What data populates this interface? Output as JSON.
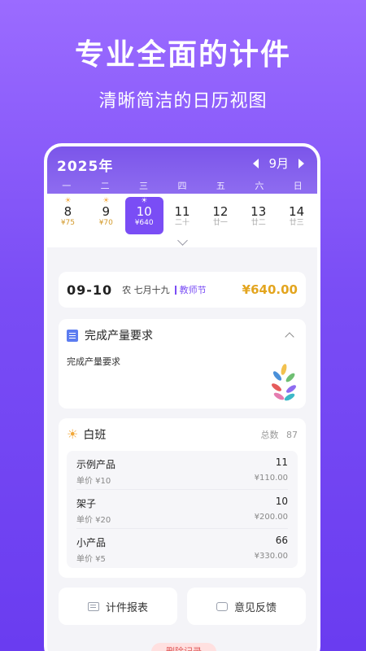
{
  "hero": {
    "title": "专业全面的计件",
    "subtitle": "清晰简洁的日历视图"
  },
  "calendar": {
    "year": "2025年",
    "month": "9月",
    "weekdays": [
      "一",
      "二",
      "三",
      "四",
      "五",
      "六",
      "日"
    ],
    "days": [
      {
        "num": "8",
        "sun": "☀",
        "sub": "¥75"
      },
      {
        "num": "9",
        "sun": "☀",
        "sub": "¥70"
      },
      {
        "num": "10",
        "sun": "☀",
        "sub": "¥640"
      },
      {
        "num": "11",
        "sun": "",
        "sub": "二十"
      },
      {
        "num": "12",
        "sun": "",
        "sub": "廿一"
      },
      {
        "num": "13",
        "sun": "",
        "sub": "廿二"
      },
      {
        "num": "14",
        "sun": "",
        "sub": "廿三"
      }
    ]
  },
  "date_card": {
    "date": "09-10",
    "lunar": "农  七月十九",
    "holiday": "教师节",
    "amount": "¥640.00"
  },
  "task": {
    "title": "完成产量要求",
    "body": "完成产量要求"
  },
  "shift": {
    "title": "白班",
    "total_label": "总数",
    "total_value": "87",
    "items": [
      {
        "name": "示例产品",
        "price": "单价 ¥10",
        "qty": "11",
        "sum": "¥110.00"
      },
      {
        "name": "架子",
        "price": "单价 ¥20",
        "qty": "10",
        "sum": "¥200.00"
      },
      {
        "name": "小产品",
        "price": "单价 ¥5",
        "qty": "66",
        "sum": "¥330.00"
      }
    ]
  },
  "buttons": {
    "report": "计件报表",
    "feedback": "意见反馈",
    "delete": "删除记录"
  }
}
